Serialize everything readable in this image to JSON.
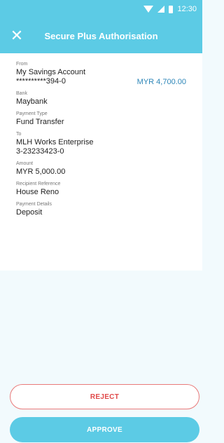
{
  "status_bar": {
    "time": "12:30"
  },
  "header": {
    "title": "Secure Plus Authorisation",
    "close_icon": "close-icon"
  },
  "details": {
    "from_label": "From",
    "from_account": "My Savings Account",
    "from_number": "**********394-0",
    "from_balance": "MYR 4,700.00",
    "bank_label": "Bank",
    "bank": "Maybank",
    "payment_type_label": "Payment Type",
    "payment_type": "Fund Transfer",
    "to_label": "To",
    "to_name": "MLH Works Enterprise",
    "to_number": "3-23233423-0",
    "amount_label": "Amount",
    "amount": "MYR 5,000.00",
    "recipient_ref_label": "Recipient Reference",
    "recipient_ref": "House Reno",
    "payment_details_label": "Payment Details",
    "payment_details": "Deposit"
  },
  "actions": {
    "reject_label": "REJECT",
    "approve_label": "APPROVE"
  },
  "colors": {
    "primary": "#5ccbe5",
    "reject": "#e04848",
    "balance": "#2d86b8"
  }
}
